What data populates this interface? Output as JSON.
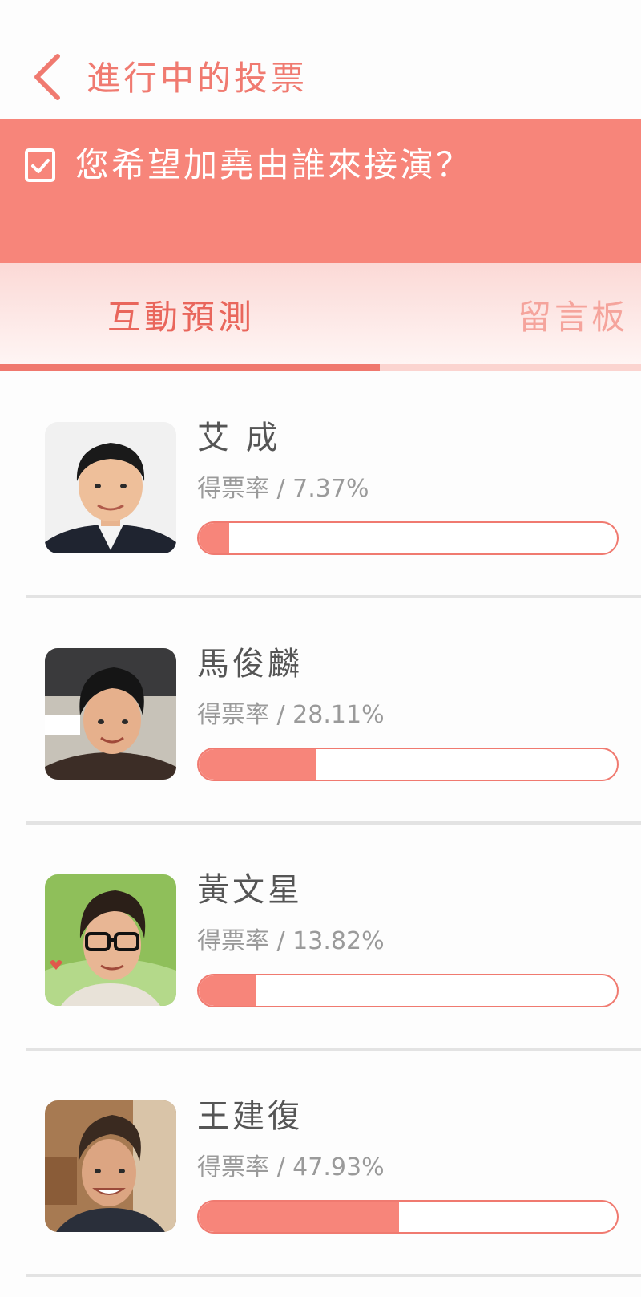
{
  "header": {
    "back_icon": "chevron-left-icon",
    "title": "進行中的投票"
  },
  "question": {
    "icon": "checkbox-checked-icon",
    "text": "您希望加堯由誰來接演？"
  },
  "tabs": [
    {
      "label": "互動預測",
      "active": true
    },
    {
      "label": "留言板",
      "active": false
    }
  ],
  "colors": {
    "accent": "#f7857a",
    "accent_dark": "#e9665c",
    "tab_inactive": "#f5a49c",
    "divider": "#e3e3e3"
  },
  "candidates": [
    {
      "name": "艾 成",
      "rate_label": "得票率 / 7.37%",
      "rate": 7.37
    },
    {
      "name": "馬俊麟",
      "rate_label": "得票率 / 28.11%",
      "rate": 28.11
    },
    {
      "name": "黃文星",
      "rate_label": "得票率 / 13.82%",
      "rate": 13.82
    },
    {
      "name": "王建復",
      "rate_label": "得票率 / 47.93%",
      "rate": 47.93
    }
  ]
}
